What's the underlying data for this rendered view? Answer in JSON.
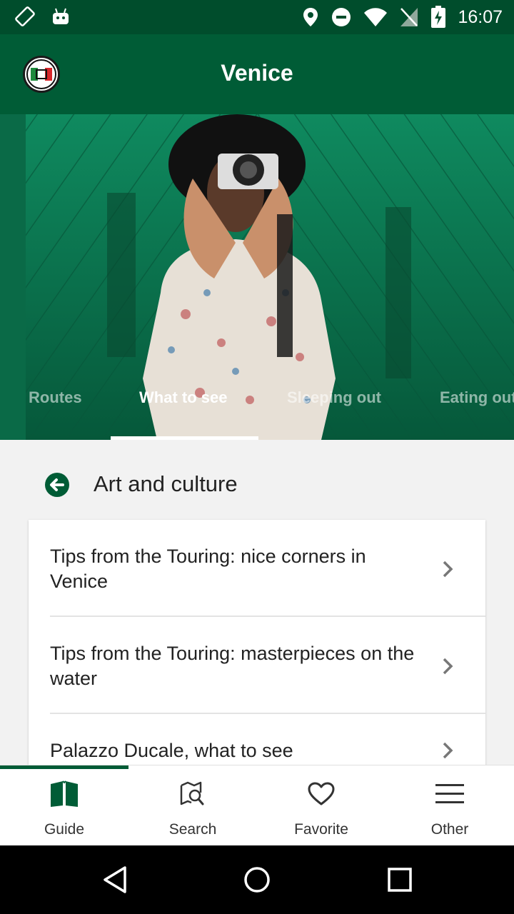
{
  "status_bar": {
    "time": "16:07",
    "icons": [
      "screen-rotation-icon",
      "android-icon",
      "location-icon",
      "do-not-disturb-icon",
      "wifi-icon",
      "no-sim-icon",
      "battery-charging-icon"
    ]
  },
  "app_bar": {
    "title": "Venice",
    "logo": "touring-club-italiano-logo"
  },
  "tabs": [
    {
      "label": "Routes",
      "active": false
    },
    {
      "label": "What to see",
      "active": true
    },
    {
      "label": "Sleeping out",
      "active": false
    },
    {
      "label": "Eating out",
      "active": false
    }
  ],
  "section": {
    "back_icon": "arrow-left-icon",
    "title": "Art and culture"
  },
  "list": [
    {
      "title": "Tips from the Touring: nice corners in Venice"
    },
    {
      "title": "Tips from the Touring: masterpieces on the water"
    },
    {
      "title": "Palazzo Ducale, what to see"
    }
  ],
  "bottom_nav": [
    {
      "label": "Guide",
      "icon": "book-icon",
      "active": true
    },
    {
      "label": "Search",
      "icon": "map-search-icon",
      "active": false
    },
    {
      "label": "Favorite",
      "icon": "heart-icon",
      "active": false
    },
    {
      "label": "Other",
      "icon": "menu-icon",
      "active": false
    }
  ],
  "colors": {
    "primary_dark": "#004d2c",
    "primary": "#005c36",
    "hero_green": "#0e7a55"
  }
}
